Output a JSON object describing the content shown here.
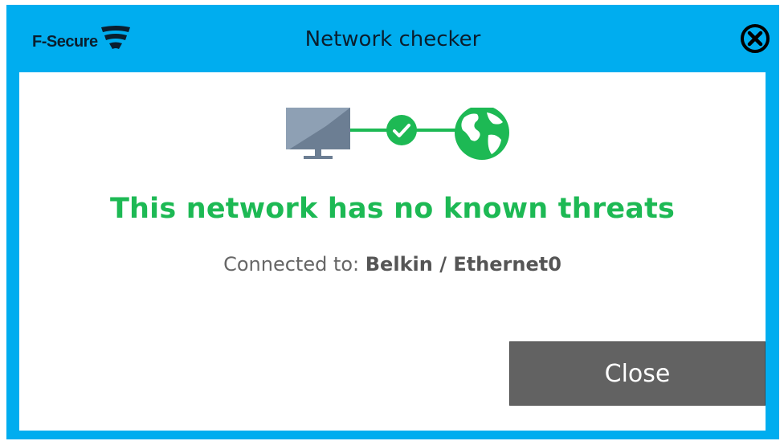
{
  "window": {
    "brand": "F-Secure",
    "title": "Network checker",
    "close_icon": "close-circle-icon"
  },
  "status": {
    "headline": "This network has no known threats",
    "connected_label": "Connected to:",
    "connected_value": "Belkin / Ethernet0",
    "icons": [
      "monitor-icon",
      "check-circle-icon",
      "globe-icon"
    ]
  },
  "actions": {
    "close_label": "Close"
  },
  "colors": {
    "frame": "#00adef",
    "success": "#1db954",
    "button": "#626262"
  }
}
